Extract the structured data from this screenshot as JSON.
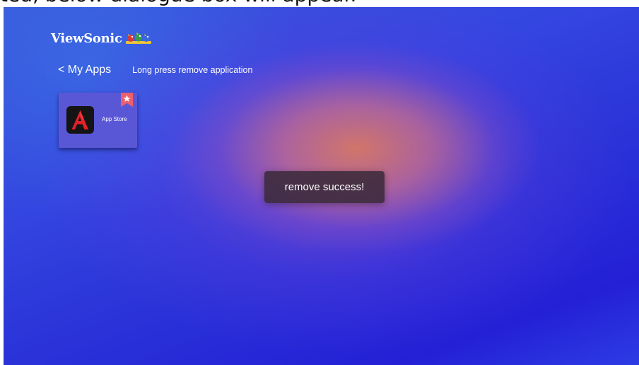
{
  "caption": {
    "text": "ted, below dialogue box will appear."
  },
  "header": {
    "brand": "ViewSonic",
    "brand_icon": "viewsonic-birds-logo"
  },
  "nav": {
    "back_label": "< My Apps",
    "hint": "Long press remove application"
  },
  "apps": [
    {
      "label": "App Store",
      "icon": "app-store-icon",
      "badge_icon": "star-bookmark-icon"
    }
  ],
  "toast": {
    "message": "remove success!"
  },
  "colors": {
    "background_primary": "#2a33d8",
    "glow": "#d67864",
    "tile": "#5a57d6",
    "app_icon_red": "#e3202a",
    "badge": "#ec5f6e",
    "toast_bg": "#3a2a3a"
  }
}
